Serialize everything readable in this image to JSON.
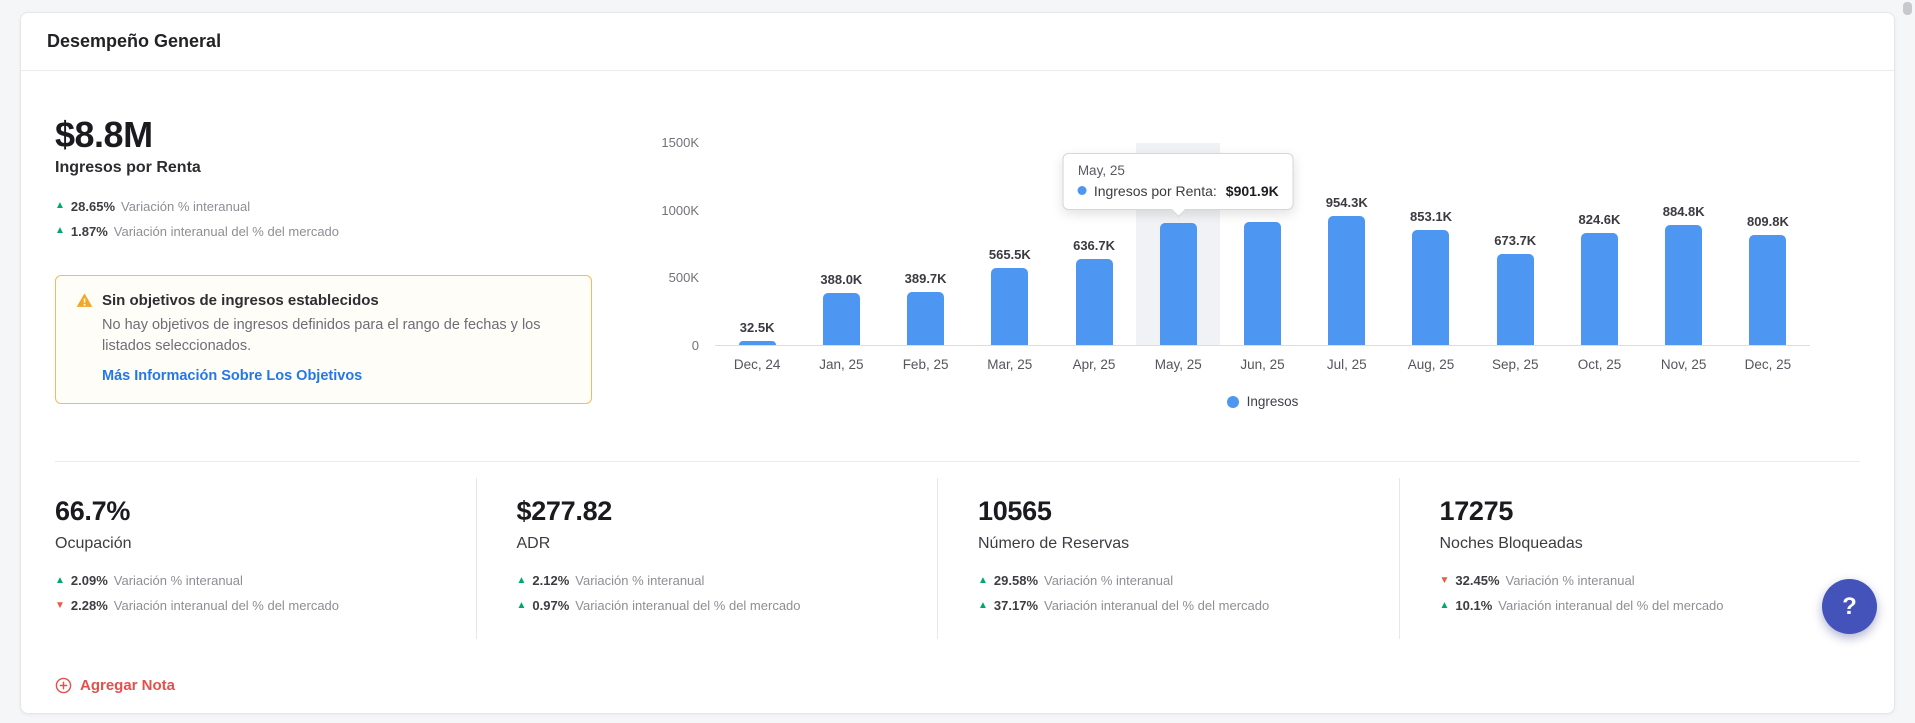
{
  "page": {
    "title": "Desempeño General"
  },
  "revenue": {
    "value": "$8.8M",
    "label": "Ingresos por Renta",
    "variations": [
      {
        "direction": "up",
        "percent": "28.65%",
        "text": "Variación % interanual"
      },
      {
        "direction": "up",
        "percent": "1.87%",
        "text": "Variación interanual del % del mercado"
      }
    ]
  },
  "warning": {
    "title": "Sin objetivos de ingresos establecidos",
    "body": "No hay objetivos de ingresos definidos para el rango de fechas y los listados seleccionados.",
    "link_label": "Más Información Sobre Los Objetivos"
  },
  "chart_data": {
    "type": "bar",
    "categories": [
      "Dec, 24",
      "Jan, 25",
      "Feb, 25",
      "Mar, 25",
      "Apr, 25",
      "May, 25",
      "Jun, 25",
      "Jul, 25",
      "Aug, 25",
      "Sep, 25",
      "Oct, 25",
      "Nov, 25",
      "Dec, 25"
    ],
    "series": [
      {
        "name": "Ingresos",
        "values": [
          32500,
          388000,
          389700,
          565500,
          636700,
          901900,
          910000,
          954300,
          853100,
          673700,
          824600,
          884800,
          809800
        ]
      }
    ],
    "bar_value_labels": [
      "32.5K",
      "388.0K",
      "389.7K",
      "565.5K",
      "636.7K",
      "",
      "",
      "954.3K",
      "853.1K",
      "673.7K",
      "824.6K",
      "884.8K",
      "809.8K"
    ],
    "ylim": [
      0,
      1500000
    ],
    "yticks": [
      0,
      500000,
      1000000,
      1500000
    ],
    "ytick_labels": [
      "0",
      "500K",
      "1000K",
      "1500K"
    ],
    "grid": false,
    "legend": {
      "position": "bottom",
      "entries": [
        {
          "label": "Ingresos",
          "color": "#4d96f1"
        }
      ]
    },
    "hover_index": 5,
    "tooltip": {
      "title": "May, 25",
      "series_label": "Ingresos por Renta:",
      "value": "$901.9K"
    }
  },
  "kpis": [
    {
      "value": "66.7%",
      "label": "Ocupación",
      "variations": [
        {
          "direction": "up",
          "percent": "2.09%",
          "text": "Variación % interanual"
        },
        {
          "direction": "down",
          "percent": "2.28%",
          "text": "Variación interanual del % del mercado"
        }
      ]
    },
    {
      "value": "$277.82",
      "label": "ADR",
      "variations": [
        {
          "direction": "up",
          "percent": "2.12%",
          "text": "Variación % interanual"
        },
        {
          "direction": "up",
          "percent": "0.97%",
          "text": "Variación interanual del % del mercado"
        }
      ]
    },
    {
      "value": "10565",
      "label": "Número de Reservas",
      "variations": [
        {
          "direction": "up",
          "percent": "29.58%",
          "text": "Variación % interanual"
        },
        {
          "direction": "up",
          "percent": "37.17%",
          "text": "Variación interanual del % del mercado"
        }
      ]
    },
    {
      "value": "17275",
      "label": "Noches Bloqueadas",
      "variations": [
        {
          "direction": "down",
          "percent": "32.45%",
          "text": "Variación % interanual"
        },
        {
          "direction": "up",
          "percent": "10.1%",
          "text": "Variación interanual del % del mercado"
        }
      ]
    }
  ],
  "footer": {
    "add_note_label": "Agregar Nota"
  },
  "help": {
    "label": "?"
  },
  "colors": {
    "bar": "#4d96f1",
    "positive": "#00a86f",
    "negative": "#ee5a3f",
    "link": "#2477e8",
    "warning_border": "#f2bb61",
    "warning_icon": "#f5a623",
    "note": "#e4504b",
    "help_background": "#4353b9"
  }
}
